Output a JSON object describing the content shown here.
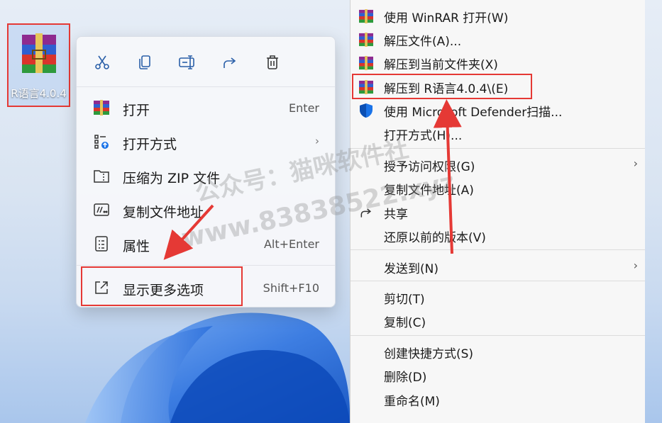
{
  "desktop_file": {
    "label": "R语言4.0.4"
  },
  "compact_menu": {
    "toolbar": [
      {
        "icon": "scissors-icon",
        "tooltip": "Cut"
      },
      {
        "icon": "copy-icon",
        "tooltip": "Copy"
      },
      {
        "icon": "rename-icon",
        "tooltip": "Rename"
      },
      {
        "icon": "share-icon",
        "tooltip": "Share"
      },
      {
        "icon": "trash-icon",
        "tooltip": "Delete"
      }
    ],
    "items": [
      {
        "label": "打开",
        "shortcut": "Enter",
        "icon": "winrar-icon"
      },
      {
        "label": "打开方式",
        "shortcut": "",
        "icon": "open-with-icon",
        "submenu": true
      },
      {
        "label": "压缩为 ZIP 文件",
        "shortcut": "",
        "icon": "zip-folder-icon"
      },
      {
        "label": "复制文件地址",
        "shortcut": "",
        "icon": "copy-path-icon"
      },
      {
        "label": "属性",
        "shortcut": "Alt+Enter",
        "icon": "properties-icon"
      },
      {
        "label": "显示更多选项",
        "shortcut": "Shift+F10",
        "icon": "more-options-icon"
      }
    ],
    "submenu_glyph": "›"
  },
  "classic_menu": {
    "items": [
      {
        "label": "使用 WinRAR 打开(W)",
        "icon": "winrar-icon"
      },
      {
        "label": "解压文件(A)...",
        "icon": "winrar-icon"
      },
      {
        "label": "解压到当前文件夹(X)",
        "icon": "winrar-icon"
      },
      {
        "label": "解压到 R语言4.0.4\\(E)",
        "icon": "winrar-icon"
      },
      {
        "label": "使用 Microsoft Defender扫描...",
        "icon": "defender-shield-icon"
      },
      {
        "label": "打开方式(H)...",
        "icon": ""
      },
      {
        "label": "授予访问权限(G)",
        "icon": "",
        "submenu": true
      },
      {
        "label": "复制文件地址(A)",
        "icon": ""
      },
      {
        "label": "共享",
        "icon": "share-icon"
      },
      {
        "label": "还原以前的版本(V)",
        "icon": ""
      },
      {
        "label": "发送到(N)",
        "icon": "",
        "submenu": true
      },
      {
        "label": "剪切(T)",
        "icon": ""
      },
      {
        "label": "复制(C)",
        "icon": ""
      },
      {
        "label": "创建快捷方式(S)",
        "icon": ""
      },
      {
        "label": "删除(D)",
        "icon": ""
      },
      {
        "label": "重命名(M)",
        "icon": ""
      }
    ],
    "submenu_glyph": "›"
  },
  "watermark": {
    "line1": "公众号：猫咪软件社",
    "line2": "www.83838522.xyz"
  },
  "colors": {
    "highlight": "#e53935",
    "accent": "#1a73e8"
  }
}
